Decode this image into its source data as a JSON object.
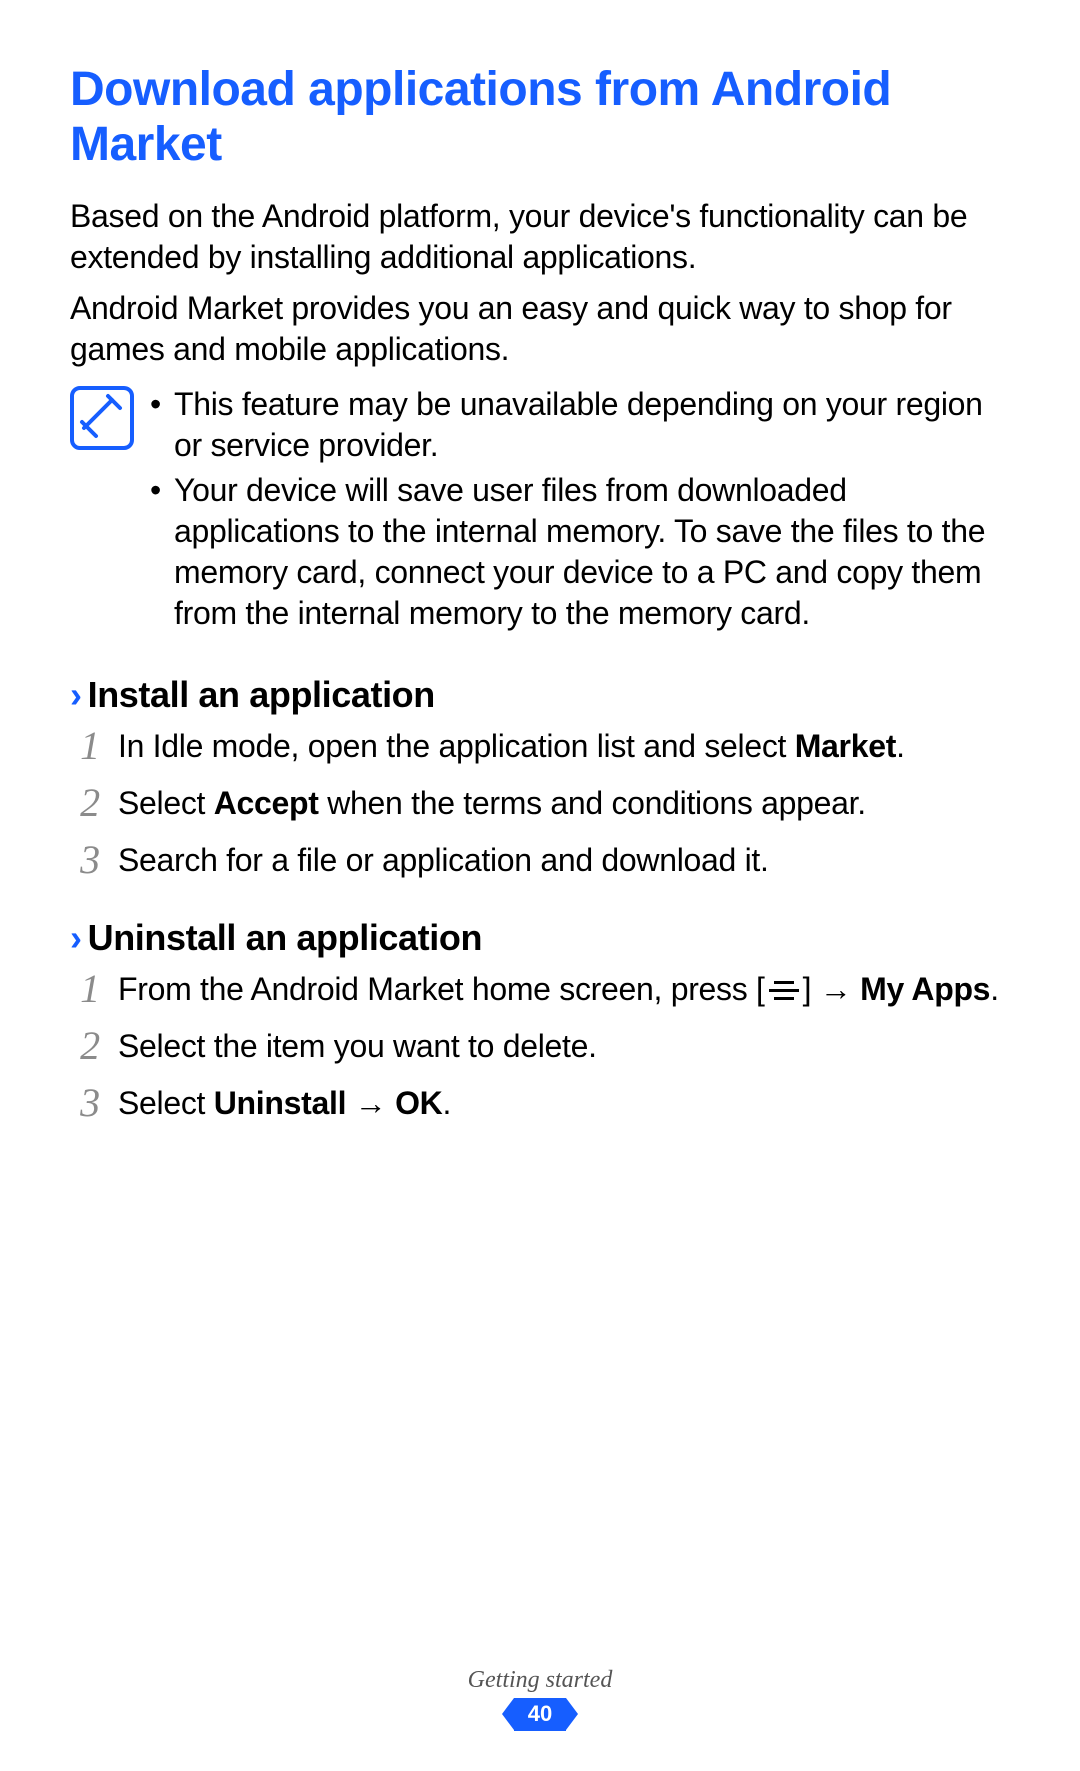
{
  "title": "Download applications from Android Market",
  "intro_p1": "Based on the Android platform, your device's functionality can be extended by installing additional applications.",
  "intro_p2": "Android Market provides you an easy and quick way to shop for games and mobile applications.",
  "notes": {
    "item1": "This feature may be unavailable depending on your region or service provider.",
    "item2": "Your device will save user files from downloaded applications to the internal memory. To save the files to the memory card, connect your device to a PC and copy them from the internal memory to the memory card."
  },
  "sections": {
    "install": {
      "heading": "Install an application",
      "step1_pre": "In Idle mode, open the application list and select ",
      "step1_bold": "Market",
      "step1_post": ".",
      "step2_pre": "Select ",
      "step2_bold": "Accept",
      "step2_post": " when the terms and conditions appear.",
      "step3": "Search for a file or application and download it."
    },
    "uninstall": {
      "heading": "Uninstall an application",
      "step1_pre": "From the Android Market home screen, press [",
      "step1_mid": "] → ",
      "step1_bold": "My Apps",
      "step1_post": ".",
      "step2": "Select the item you want to delete.",
      "step3_pre": "Select ",
      "step3_bold1": "Uninstall",
      "step3_arrow": " → ",
      "step3_bold2": "OK",
      "step3_post": "."
    }
  },
  "footer": {
    "section": "Getting started",
    "page": "40"
  },
  "ui": {
    "chevron": "›"
  }
}
